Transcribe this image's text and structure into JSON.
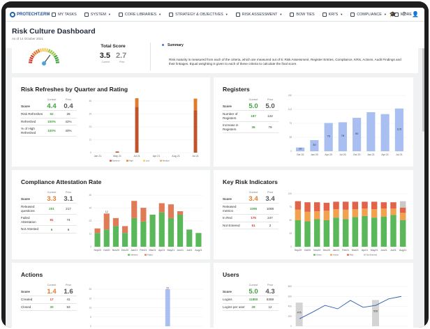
{
  "nav": {
    "logo": "PROTECHT.ERM",
    "items": [
      {
        "label": "MY TASKS",
        "icon": "list-icon",
        "caret": false
      },
      {
        "label": "SYSTEM",
        "icon": "gear-icon",
        "caret": true
      },
      {
        "label": "CORE LIBRARIES",
        "icon": "library-icon",
        "caret": true
      },
      {
        "label": "STRATEGY & OBJECTIVES",
        "icon": "strategy-icon",
        "caret": true
      },
      {
        "label": "RISK ASSESSMENT",
        "icon": "risk-icon",
        "caret": true
      },
      {
        "label": "BOW TIES",
        "icon": "bowtie-icon",
        "caret": false
      },
      {
        "label": "KRI'S",
        "icon": "kri-icon",
        "caret": true
      },
      {
        "label": "COMPLIANCE",
        "icon": "compliance-icon",
        "caret": true
      },
      {
        "label": "MORE",
        "icon": "more-icon",
        "caret": true
      }
    ],
    "right_icons": [
      "graduation-cap-icon",
      "help-icon",
      "user-icon"
    ],
    "right_glyphs": [
      "🎓",
      "?",
      "👤"
    ]
  },
  "header": {
    "title": "Risk Culture Dashboard",
    "as_of": "As of 14 October 2021"
  },
  "summary": {
    "total_score_label": "Total Score",
    "current": "3.5",
    "prior": "2.7",
    "current_label": "Current",
    "prior_label": "Prior",
    "gauge_value": 3.5,
    "gauge_max": 5,
    "heading": "Summary",
    "text": "Risk maturity is measured from each of the criteria, which are measured out of 5: Risk Assessment, Register Entries, Compliance, KRIs, Actions, Audit Findings and their linkages. Equal weighting is given to each of these criteria to calculate the final score."
  },
  "colors": {
    "green": "#3fa23c",
    "orange": "#e07b2c",
    "red": "#d23b2a",
    "blue": "#a9bff2",
    "gray": "#c9c9c9",
    "yellow": "#f1c95e"
  },
  "panels": {
    "refreshes": {
      "title": "Risk Refreshes by Quarter and Rating",
      "hdr_current": "Current",
      "hdr_prior": "Prior",
      "rows": [
        {
          "label": "Score",
          "current": "4.4",
          "prior": "0.4",
          "cls": "score green"
        },
        {
          "label": "Risk Refreshes",
          "current": "62",
          "prior": "26",
          "cls": "green"
        },
        {
          "label": "Refreshed",
          "current": "100%",
          "prior": "42%",
          "cls": "green"
        },
        {
          "label": "% of High Refreshed",
          "current": "100%",
          "prior": "40%",
          "cls": "green"
        }
      ]
    },
    "registers": {
      "title": "Registers",
      "hdr_current": "Current",
      "hdr_prior": "Prior",
      "rows": [
        {
          "label": "Score",
          "current": "5.0",
          "prior": "5.0",
          "cls": "score green"
        },
        {
          "label": "Number of Registers",
          "current": "187",
          "prior": "122",
          "cls": "green"
        },
        {
          "label": "Increase in Registers",
          "current": "36",
          "prior": "79",
          "cls": "green"
        }
      ]
    },
    "compliance": {
      "title": "Compliance Attestation Rate",
      "hdr_current": "Current",
      "hdr_prior": "Prior",
      "rows": [
        {
          "label": "Score",
          "current": "3.3",
          "prior": "3.1",
          "cls": "score orange"
        },
        {
          "label": "Released questions",
          "current": "201",
          "prior": "217",
          "cls": "green"
        },
        {
          "label": "Failed Attestation",
          "current": "81",
          "prior": "74",
          "cls": "red"
        },
        {
          "label": "Not Attested",
          "current": "6",
          "prior": "6",
          "cls": "green"
        }
      ]
    },
    "kri": {
      "title": "Key Risk Indicators",
      "hdr_current": "Current",
      "hdr_prior": "Prior",
      "rows": [
        {
          "label": "Score",
          "current": "3.4",
          "prior": "3.4",
          "cls": "score orange"
        },
        {
          "label": "Released metrics",
          "current": "1095",
          "prior": "1088",
          "cls": "green"
        },
        {
          "label": "In Red",
          "current": "175",
          "prior": "247",
          "cls": "red"
        },
        {
          "label": "Not Entered",
          "current": "51",
          "prior": "2",
          "cls": "red"
        }
      ]
    },
    "actions": {
      "title": "Actions",
      "hdr_current": "Current",
      "hdr_prior": "Prior",
      "rows": [
        {
          "label": "Score",
          "current": "1.4",
          "prior": "1.6",
          "cls": "score orange"
        },
        {
          "label": "Created",
          "current": "17",
          "prior": "41",
          "cls": "red"
        },
        {
          "label": "Closed",
          "current": "20",
          "prior": "53",
          "cls": "green"
        }
      ]
    },
    "users": {
      "title": "Users",
      "hdr_current": "Current",
      "hdr_prior": "Prior",
      "rows": [
        {
          "label": "Score",
          "current": "5.0",
          "prior": "4.3",
          "cls": "score green"
        },
        {
          "label": "Logins",
          "current": "11850",
          "prior": "6359",
          "cls": "green"
        },
        {
          "label": "Logins per user",
          "current": "28",
          "prior": "12",
          "cls": "green"
        }
      ]
    }
  },
  "chart_data": [
    {
      "id": "refreshes",
      "type": "bar",
      "categories": [
        "Jan 21",
        "",
        "May 21",
        "",
        "Jul 21",
        "",
        "Apr 21",
        "",
        "Aug 21",
        "",
        "Jul 21"
      ],
      "series": [
        {
          "name": "Extreme",
          "color": "#c0532a",
          "values": [
            0,
            0,
            1,
            0,
            40,
            0,
            0,
            0,
            0,
            0,
            37
          ]
        },
        {
          "name": "High",
          "color": "#e07b2c",
          "values": [
            0,
            0,
            0,
            0,
            26,
            0,
            0,
            0,
            0,
            0,
            10
          ]
        },
        {
          "name": "Low",
          "color": "#f1c95e",
          "values": [
            0,
            0,
            0,
            0,
            4,
            0,
            0,
            0,
            0,
            0,
            5
          ]
        },
        {
          "name": "Medium",
          "color": "#f3a65b",
          "values": [
            0,
            0,
            0,
            0,
            7,
            0,
            0,
            0,
            0,
            0,
            0
          ]
        }
      ],
      "data_labels": [
        "",
        "",
        "",
        "",
        "42",
        "",
        "",
        "",
        "",
        "",
        "37"
      ],
      "ylim": [
        0,
        45
      ]
    },
    {
      "id": "registers",
      "type": "bar",
      "categories": [
        "Oct 19",
        "Jan 20",
        "Apr 20",
        "Jul 20",
        "Oct 20",
        "Jan 21",
        "Apr 21",
        "Jul 21"
      ],
      "values": [
        10,
        30,
        76,
        78,
        90,
        105,
        100,
        115
      ],
      "data_labels": [
        "10",
        "30",
        "76",
        "78",
        "90",
        "",
        "",
        "115"
      ],
      "series_name": "Number of Registers",
      "ylim": [
        0,
        150
      ]
    },
    {
      "id": "compliance",
      "type": "bar",
      "categories": [
        "Sep20",
        "Oct20",
        "Nov20",
        "Dec20",
        "Jan21",
        "Feb21",
        "Mar21",
        "Apr21",
        "May21",
        "Jun21",
        "Jul21",
        "Aug21"
      ],
      "series": [
        {
          "name": "Attested",
          "color": "#5bb85a",
          "values": [
            12,
            15,
            18,
            12,
            25,
            22,
            28,
            30,
            25,
            28,
            15,
            12
          ]
        },
        {
          "name": "Failed",
          "color": "#e07b58",
          "values": [
            4,
            14,
            7,
            6,
            15,
            12,
            0,
            8,
            12,
            3,
            0,
            0
          ]
        }
      ],
      "data_labels": [
        "",
        "12",
        "",
        "",
        "",
        "",
        "",
        "",
        "",
        "",
        "",
        ""
      ],
      "ylim": [
        0,
        45
      ]
    },
    {
      "id": "kri",
      "type": "bar",
      "categories": [
        "Sep20",
        "Oct20",
        "Nov20",
        "Dec20",
        "Jan21",
        "Feb21",
        "Mar21",
        "Apr21",
        "May21",
        "Jun21",
        "Jul21",
        "Aug21"
      ],
      "series": [
        {
          "name": "Green",
          "color": "#5bb85a",
          "values": [
            50,
            48,
            52,
            50,
            55,
            52,
            56,
            58,
            55,
            57,
            60,
            50
          ]
        },
        {
          "name": "Amber",
          "color": "#f2a24e",
          "values": [
            20,
            18,
            15,
            18,
            16,
            18,
            15,
            14,
            16,
            15,
            12,
            14
          ]
        },
        {
          "name": "Red",
          "color": "#e0634a",
          "values": [
            16,
            18,
            17,
            15,
            14,
            15,
            14,
            13,
            14,
            12,
            12,
            10
          ]
        },
        {
          "name": "Not Entered",
          "color": "#c9c9c9",
          "values": [
            0,
            0,
            0,
            0,
            0,
            0,
            0,
            0,
            0,
            0,
            0,
            12
          ]
        }
      ],
      "ylim": [
        0,
        100
      ]
    },
    {
      "id": "actions",
      "type": "bar",
      "values": [
        22
      ],
      "data_labels": [
        "22"
      ],
      "ylim": [
        0,
        25
      ]
    },
    {
      "id": "users",
      "type": "line",
      "bar_values": [
        476,
        0,
        0,
        0,
        0,
        0,
        528,
        0,
        0
      ],
      "bar_labels": [
        "476",
        "",
        "",
        "",
        "",
        "",
        "528",
        "",
        ""
      ],
      "line_values": [
        150,
        280,
        420,
        350,
        520,
        380,
        420,
        550,
        600
      ],
      "ylim": [
        0,
        800
      ]
    }
  ]
}
